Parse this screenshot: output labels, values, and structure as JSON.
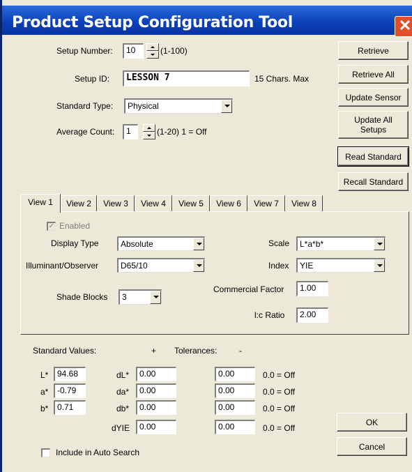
{
  "window": {
    "title": "Product Setup Configuration Tool",
    "close_glyph": "✕"
  },
  "setup": {
    "number_label": "Setup Number:",
    "number_value": "10",
    "number_range": "(1-100)",
    "id_label": "Setup ID:",
    "id_value": "LESSON 7",
    "id_hint": "15 Chars. Max",
    "standard_type_label": "Standard Type:",
    "standard_type_value": "Physical",
    "average_count_label": "Average Count:",
    "average_count_value": "1",
    "average_count_hint": "(1-20) 1 = Off"
  },
  "buttons": {
    "retrieve": "Retrieve",
    "retrieve_all": "Retrieve All",
    "update_sensor": "Update Sensor",
    "update_all_setups": "Update All Setups",
    "read_standard": "Read Standard",
    "recall_standard": "Recall Standard",
    "ok": "OK",
    "cancel": "Cancel"
  },
  "tabs": [
    "View 1",
    "View 2",
    "View 3",
    "View 4",
    "View 5",
    "View 6",
    "View 7",
    "View 8"
  ],
  "active_tab": "View 1",
  "view": {
    "enabled_label": "Enabled",
    "enabled_checked": true,
    "display_type_label": "Display Type",
    "display_type_value": "Absolute",
    "illuminant_label": "Illuminant/Observer",
    "illuminant_value": "D65/10",
    "shade_blocks_label": "Shade Blocks",
    "shade_blocks_value": "3",
    "scale_label": "Scale",
    "scale_value": "L*a*b*",
    "index_label": "Index",
    "index_value": "YIE",
    "commercial_factor_label": "Commercial Factor",
    "commercial_factor_value": "1.00",
    "lc_ratio_label": "l:c Ratio",
    "lc_ratio_value": "2.00"
  },
  "standards": {
    "standard_values_label": "Standard Values:",
    "plus_label": "+",
    "tolerances_label": "Tolerances:",
    "minus_label": "-",
    "rows": [
      {
        "std_label": "L*",
        "std_value": "94.68",
        "delta_label": "dL*",
        "plus_value": "0.00",
        "minus_value": "0.00",
        "off_hint": "0.0 = Off"
      },
      {
        "std_label": "a*",
        "std_value": "-0.79",
        "delta_label": "da*",
        "plus_value": "0.00",
        "minus_value": "0.00",
        "off_hint": "0.0 = Off"
      },
      {
        "std_label": "b*",
        "std_value": "0.71",
        "delta_label": "db*",
        "plus_value": "0.00",
        "minus_value": "0.00",
        "off_hint": "0.0 = Off"
      },
      {
        "std_label": "",
        "std_value": "",
        "delta_label": "dYIE",
        "plus_value": "0.00",
        "minus_value": "0.00",
        "off_hint": "0.0 = Off"
      }
    ],
    "include_auto_search_label": "Include in Auto Search",
    "include_auto_search_checked": false
  }
}
